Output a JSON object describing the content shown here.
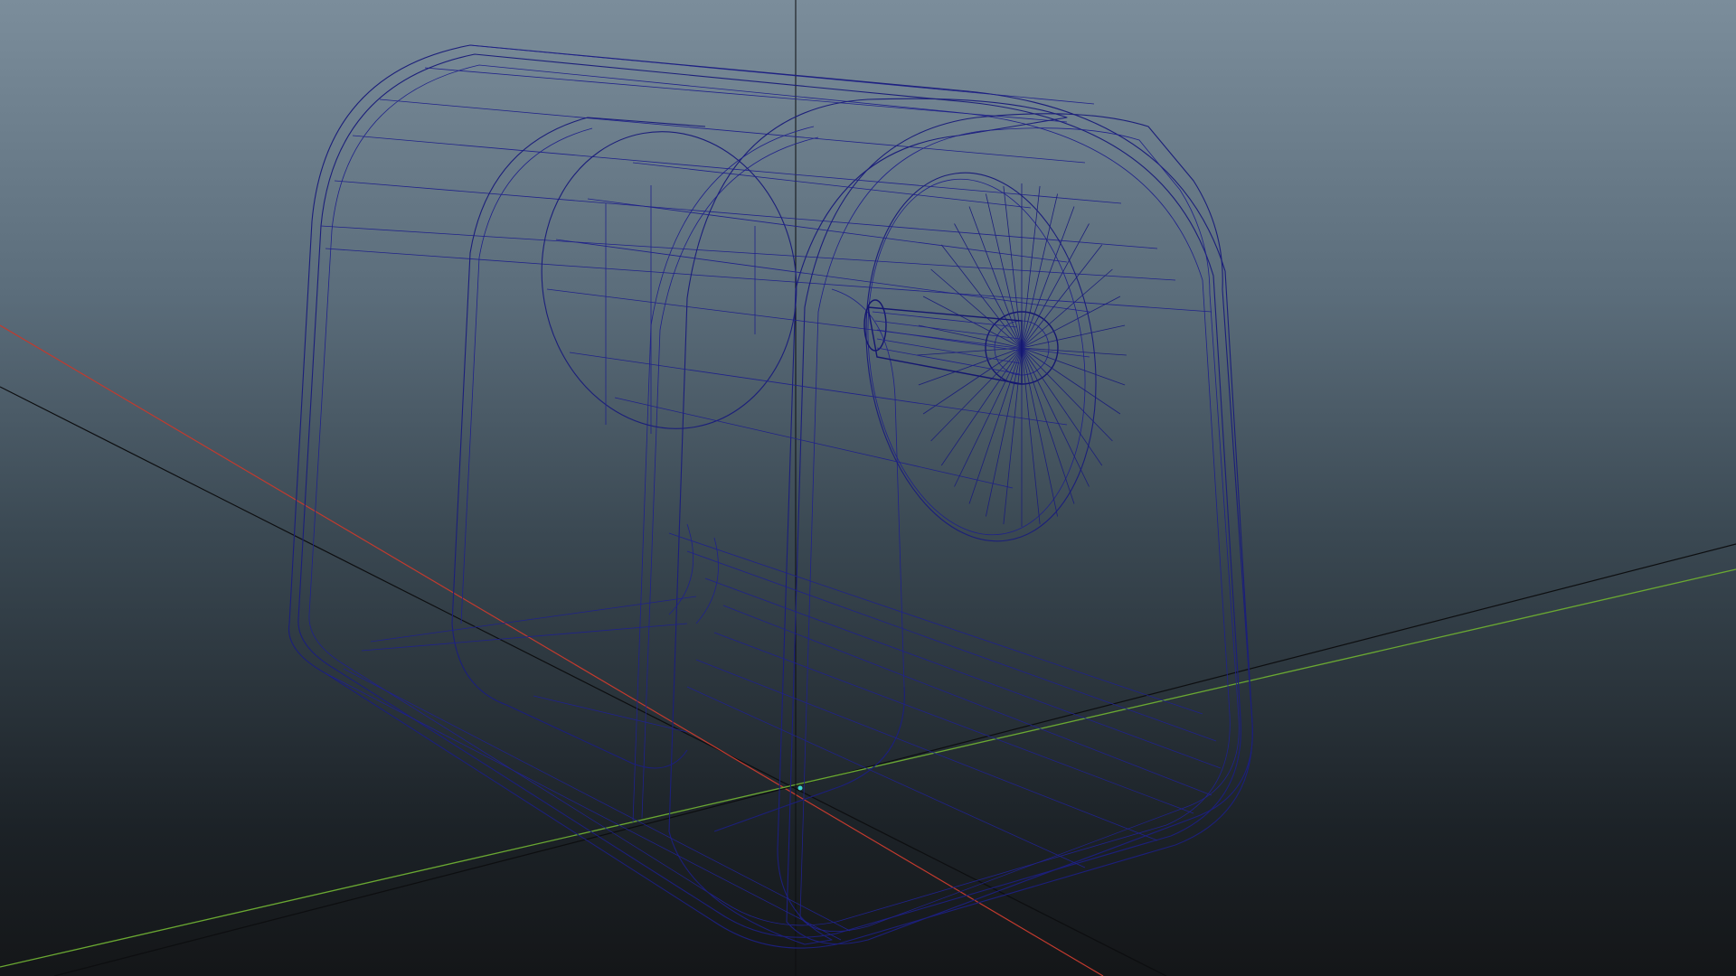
{
  "viewport": {
    "view": "perspective",
    "display_mode": "wireframe",
    "background": {
      "top": "#7b8d9b",
      "bottom": "#141618"
    }
  },
  "grid_axes": {
    "x_axis_color": "#c23a2e",
    "z_axis_color": "#6aa832",
    "grid_line_color": "#0e0f10",
    "origin_marker_color": "#3ed6d0"
  },
  "model": {
    "wire_color": "#1c1f7a",
    "parts": [
      "outer-shell",
      "inner-band",
      "front-drum",
      "hub-spokes",
      "axle-cylinder",
      "base-ribs"
    ]
  }
}
